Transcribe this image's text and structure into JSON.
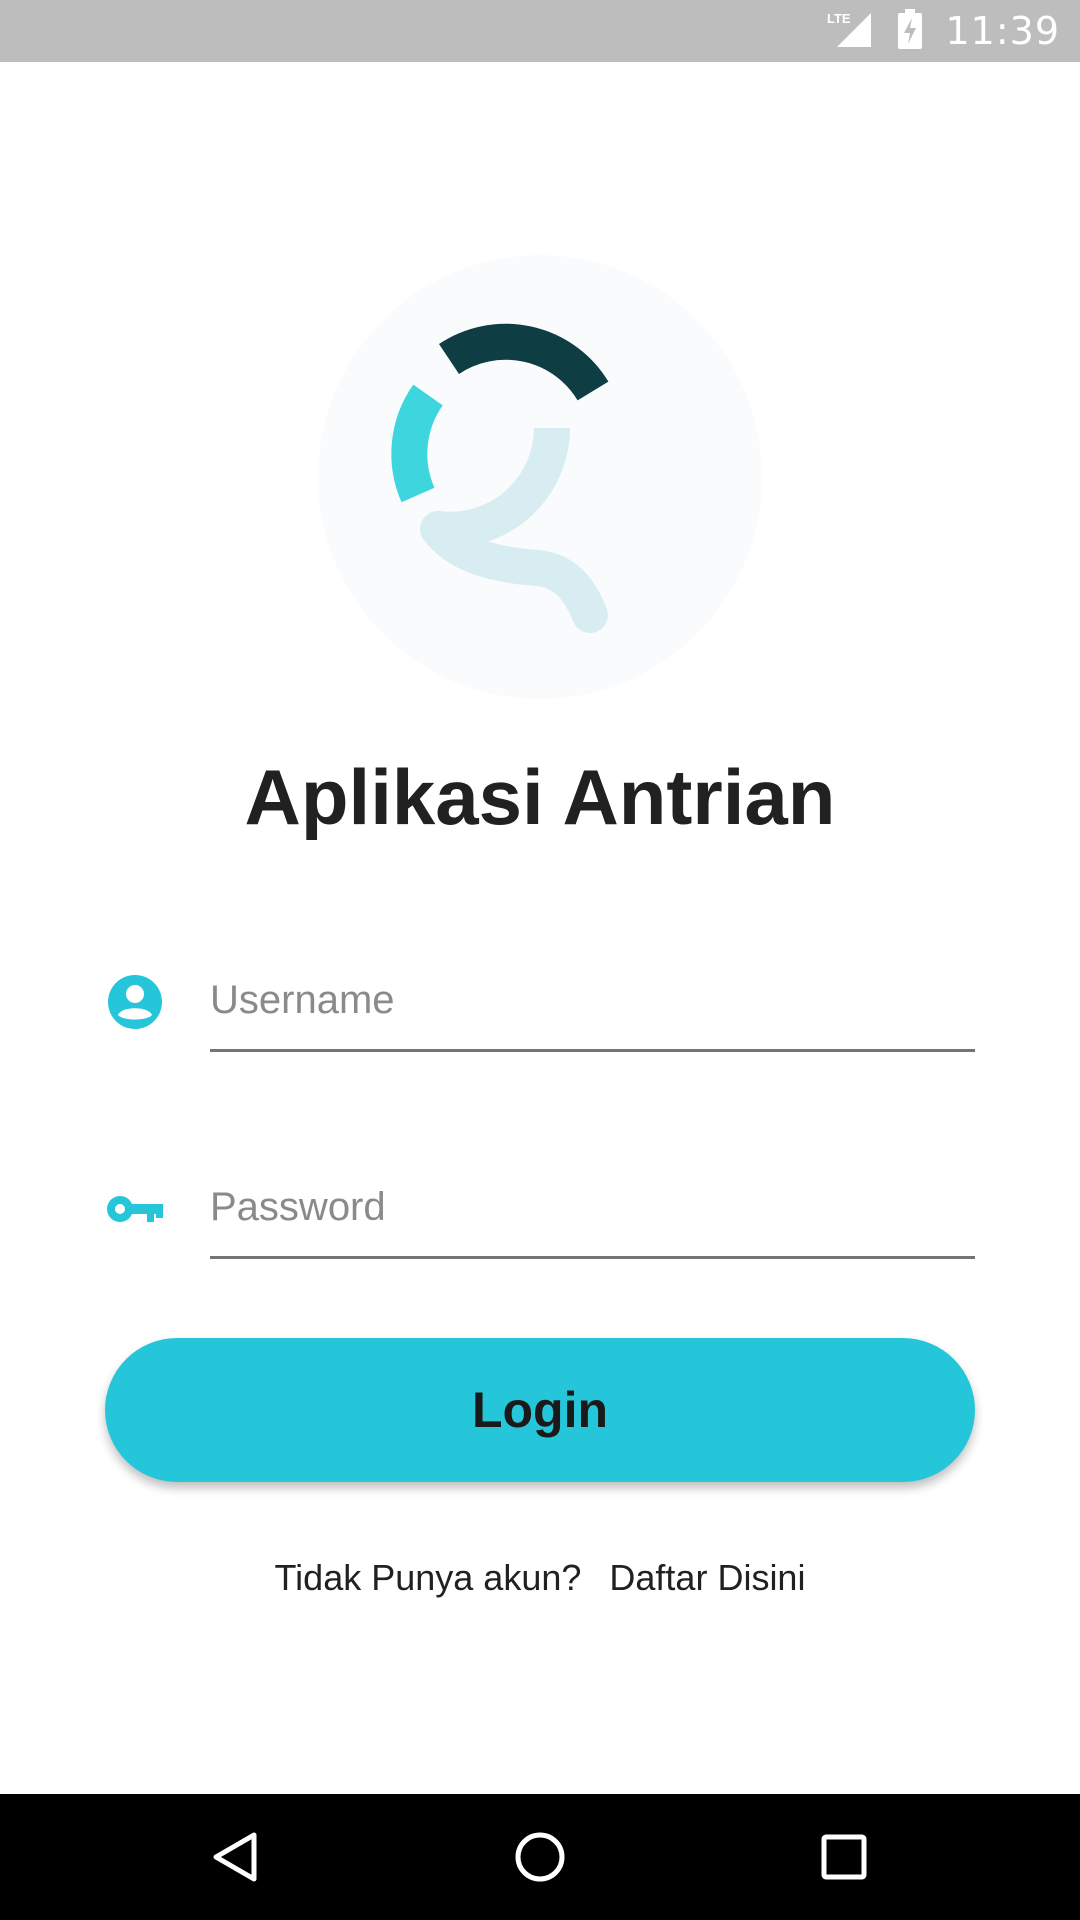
{
  "status_bar": {
    "time": "11:39",
    "network_label": "LTE",
    "icons": [
      "signal-icon",
      "battery-charging-icon"
    ]
  },
  "app": {
    "title": "Aplikasi Antrian",
    "logo": "queue-search-logo"
  },
  "form": {
    "username": {
      "placeholder": "Username",
      "value": "",
      "icon": "account-circle-icon"
    },
    "password": {
      "placeholder": "Password",
      "value": "",
      "icon": "key-icon"
    },
    "login_label": "Login"
  },
  "register": {
    "prompt": "Tidak Punya akun?",
    "link_label": "Daftar Disini"
  },
  "nav_bar": {
    "buttons": [
      "back-icon",
      "home-icon",
      "recents-icon"
    ]
  },
  "colors": {
    "accent": "#26c6da",
    "status_bar": "#bdbdbd",
    "logo_dark": "#0f3d44",
    "logo_cyan": "#3dd6de",
    "logo_light": "#d8edf2",
    "text": "#212121"
  }
}
